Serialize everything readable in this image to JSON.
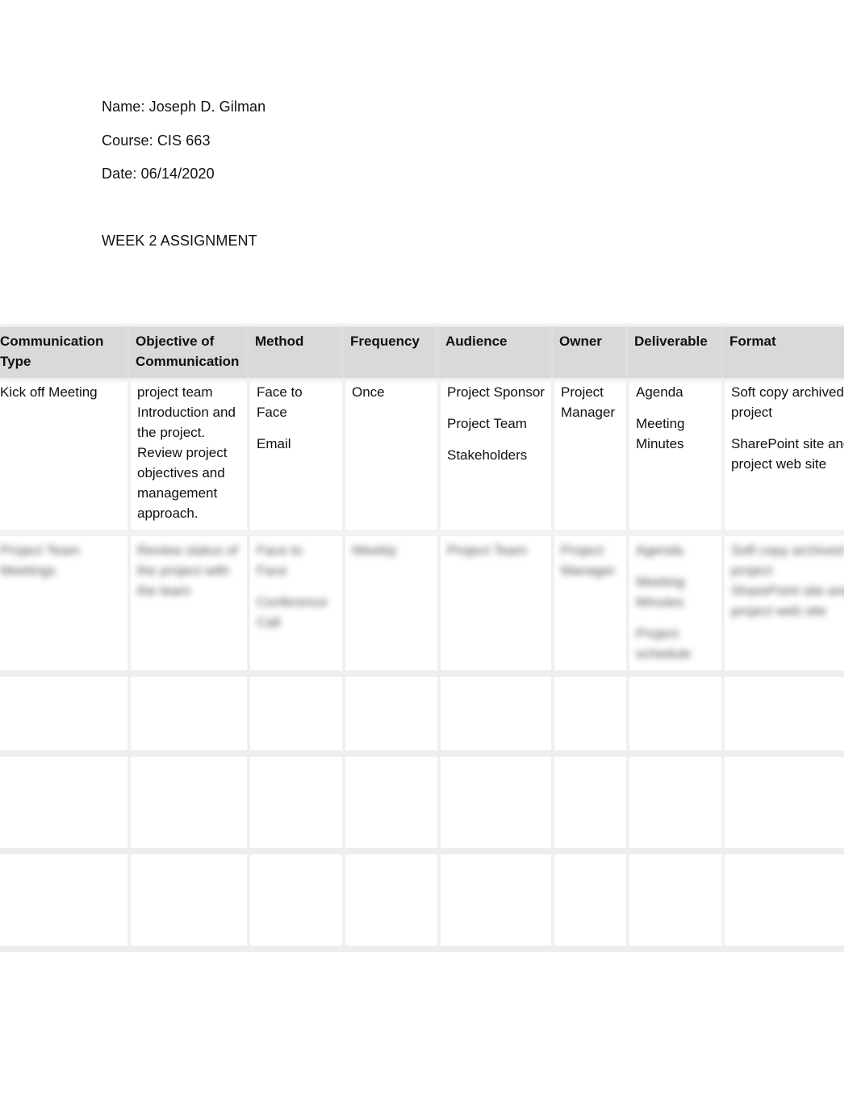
{
  "header": {
    "name": "Name: Joseph D. Gilman",
    "course": "Course: CIS 663",
    "date": "Date: 06/14/2020",
    "title": "WEEK 2 ASSIGNMENT"
  },
  "table": {
    "columns": [
      "Communication Type",
      "Objective of Communication",
      "Method",
      "Frequency",
      "Audience",
      "Owner",
      "Deliverable",
      "Format"
    ],
    "rows": [
      {
        "type": "Kick off Meeting",
        "objective": "project team Introduction and the project. Review project objectives and management approach.",
        "method": [
          "Face to Face",
          "Email"
        ],
        "frequency": "Once",
        "audience": [
          "Project Sponsor",
          "Project Team",
          "Stakeholders"
        ],
        "owner": "Project Manager",
        "deliverable": [
          "Agenda",
          "Meeting Minutes"
        ],
        "format": [
          "Soft copy archived on project",
          "SharePoint site and project web site"
        ]
      },
      {
        "blurred": true,
        "type": "Project Team Meetings",
        "objective": "Review status of the project with the team",
        "method": [
          "Face to Face",
          "Conference Call"
        ],
        "frequency": "Weekly",
        "audience": [
          "Project Team"
        ],
        "owner": "Project Manager",
        "deliverable": [
          "Agenda",
          "Meeting Minutes",
          "Project schedule"
        ],
        "format": [
          "Soft copy archived on project",
          "SharePoint site and project web site"
        ]
      }
    ]
  }
}
